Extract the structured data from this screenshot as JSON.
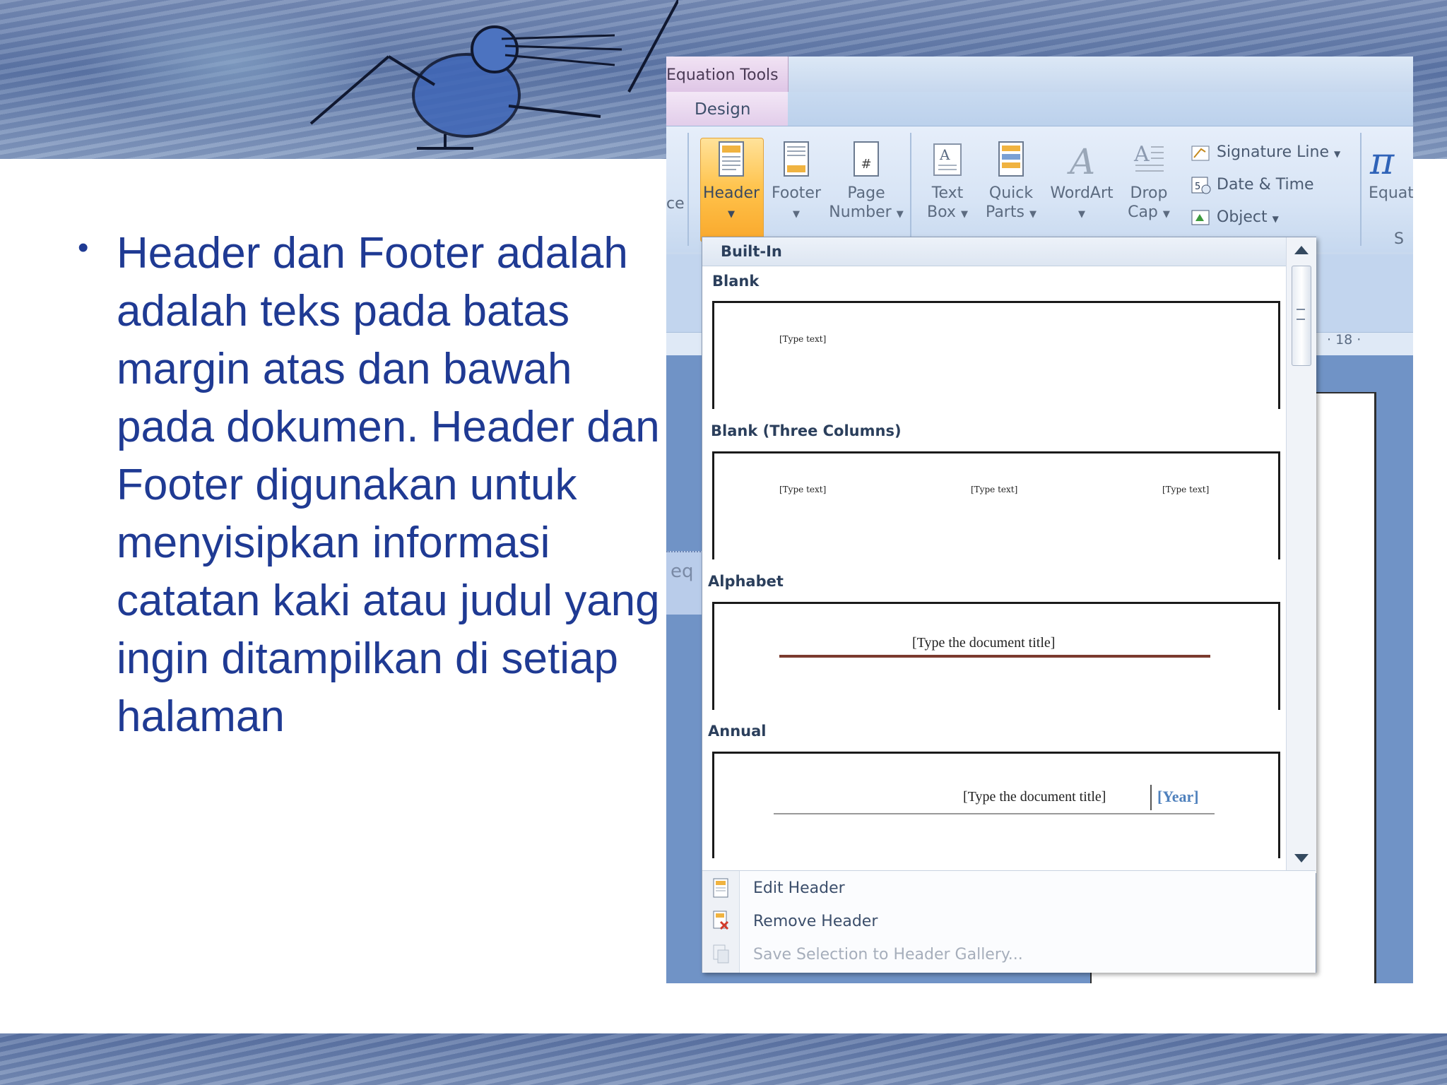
{
  "slide": {
    "bullet_text": "Header dan Footer adalah adalah teks pada batas margin atas dan bawah pada dokumen. Header dan Footer digunakan untuk menyisipkan informasi catatan kaki atau judul yang ingin ditampilkan di setiap halaman",
    "bullet_color": "#1f3a93"
  },
  "word": {
    "contextual_tab": "Equation Tools",
    "active_tab": "Design",
    "ribbon": {
      "cut_label": "ce",
      "header": "Header",
      "footer": "Footer",
      "page_number_1": "Page",
      "page_number_2": "Number",
      "text_box_1": "Text",
      "text_box_2": "Box",
      "quick_parts_1": "Quick",
      "quick_parts_2": "Parts",
      "wordart": "WordArt",
      "drop_cap_1": "Drop",
      "drop_cap_2": "Cap",
      "signature_line": "Signature Line",
      "date_time": "Date & Time",
      "object": "Object",
      "equation_partial": "Equat",
      "equation_group_partial": "S"
    },
    "ruler_number": "· 18 ·",
    "eq_partial": "eq",
    "gallery": {
      "section_header": "Built-In",
      "items": [
        {
          "title": "Blank",
          "placeholder": "[Type text]"
        },
        {
          "title": "Blank (Three Columns)",
          "placeholder": "[Type text]"
        },
        {
          "title": "Alphabet",
          "placeholder": "[Type the document title]"
        },
        {
          "title": "Annual",
          "placeholder": "[Type the document title]",
          "year": "[Year]"
        }
      ],
      "menu": {
        "edit_header": "Edit Header",
        "remove_header": "Remove Header",
        "save_selection": "Save Selection to Header Gallery..."
      }
    },
    "colors": {
      "ribbon_active": "#ffc24a",
      "contextual_tab": "#dfc6e6",
      "doc_background": "#7093c6",
      "alphabet_rule": "#7b3b2e",
      "year_accent": "#4f81bd"
    }
  }
}
